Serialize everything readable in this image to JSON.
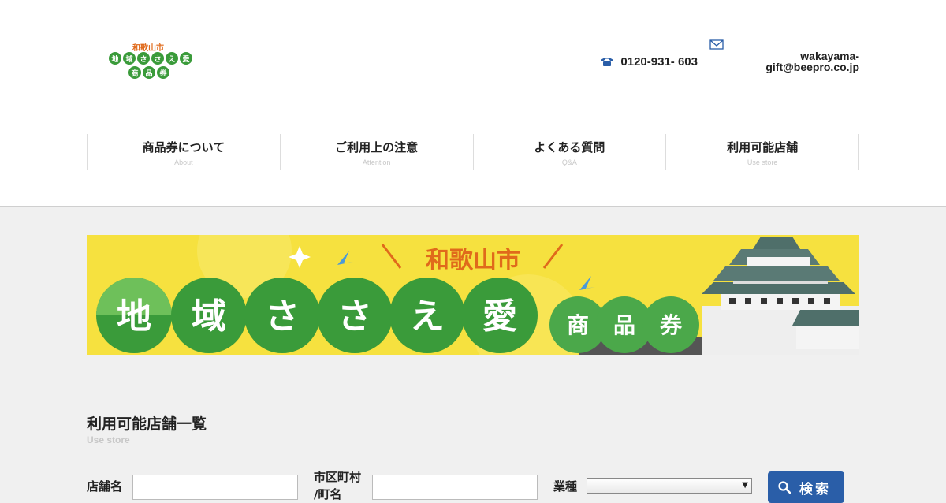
{
  "logo": {
    "tag": "和歌山市",
    "row1": [
      "地",
      "域",
      "さ",
      "さ",
      "え",
      "愛"
    ],
    "row2": [
      "商",
      "品",
      "券"
    ]
  },
  "contact": {
    "phone": "0120-931- 603",
    "email_line1": "wakayama-",
    "email_line2": "gift@beepro.co.jp"
  },
  "nav": [
    {
      "label": "商品券について",
      "sub": "About"
    },
    {
      "label": "ご利用上の注意",
      "sub": "Attention"
    },
    {
      "label": "よくある質問",
      "sub": "Q&A"
    },
    {
      "label": "利用可能店舗",
      "sub": "Use store"
    }
  ],
  "banner": {
    "city": "和歌山市",
    "main": [
      "地",
      "域",
      "さ",
      "さ",
      "え",
      "愛"
    ],
    "sub": [
      "商",
      "品",
      "券"
    ]
  },
  "section": {
    "title": "利用可能店舗一覧",
    "subtitle": "Use store"
  },
  "form": {
    "store_label": "店舗名",
    "city_label_1": "市区町村",
    "city_label_2": "/町名",
    "industry_label": "業種",
    "industry_value": "---",
    "search_label": "検索"
  },
  "colors": {
    "brand_green": "#3a9b3a",
    "accent_orange": "#e06a1b",
    "banner_yellow": "#f6e13f",
    "button_blue": "#2a5ea8"
  }
}
